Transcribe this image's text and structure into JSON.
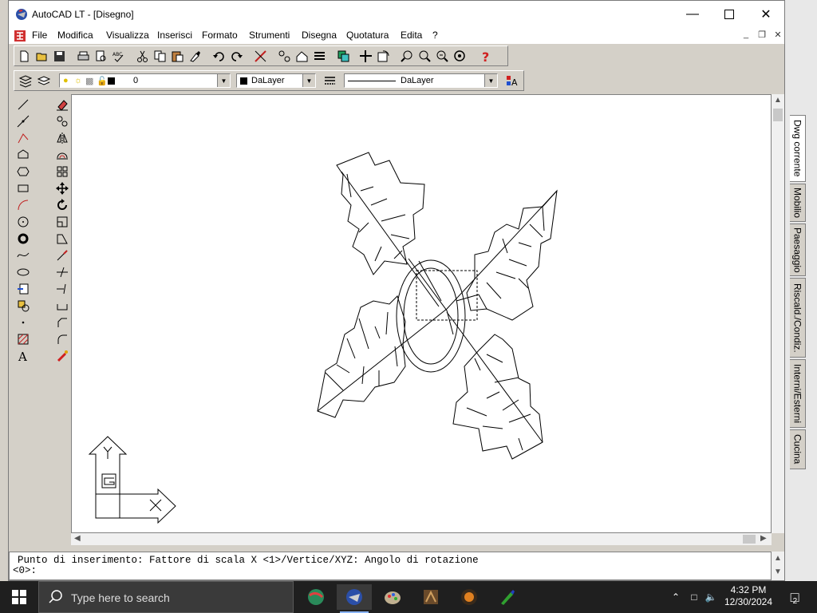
{
  "window": {
    "title": "AutoCAD LT - [Disegno]"
  },
  "menu": {
    "items": [
      "File",
      "Modifica",
      "Visualizza",
      "Inserisci",
      "Formato",
      "Strumenti",
      "Disegna",
      "Quotatura",
      "Edita",
      "?"
    ]
  },
  "layer_bar": {
    "layer_name": "0",
    "color_value": "DaLayer",
    "linetype_value": "DaLayer"
  },
  "command_line": {
    "line1": "Punto di inserimento: Fattore di scala X <1>/Vertice/XYZ:  Angolo di rotazione",
    "line2": "<0>:"
  },
  "ucs_icon": {
    "x_label": "X",
    "y_label": "Y",
    "g_label": "G"
  },
  "side_tabs": [
    "Dwg corrente",
    "Mobilio",
    "Paesaggio",
    "Riscald./Condiz.",
    "Interni/Esterni",
    "Cucina"
  ],
  "taskbar": {
    "search_placeholder": "Type here to search",
    "time": "4:32 PM",
    "date": "12/30/2024",
    "notification_count": "2"
  },
  "colors": {
    "window_bg": "#d4d0c8",
    "taskbar_bg": "#1f1f1f",
    "canvas_bg": "#ffffff"
  }
}
